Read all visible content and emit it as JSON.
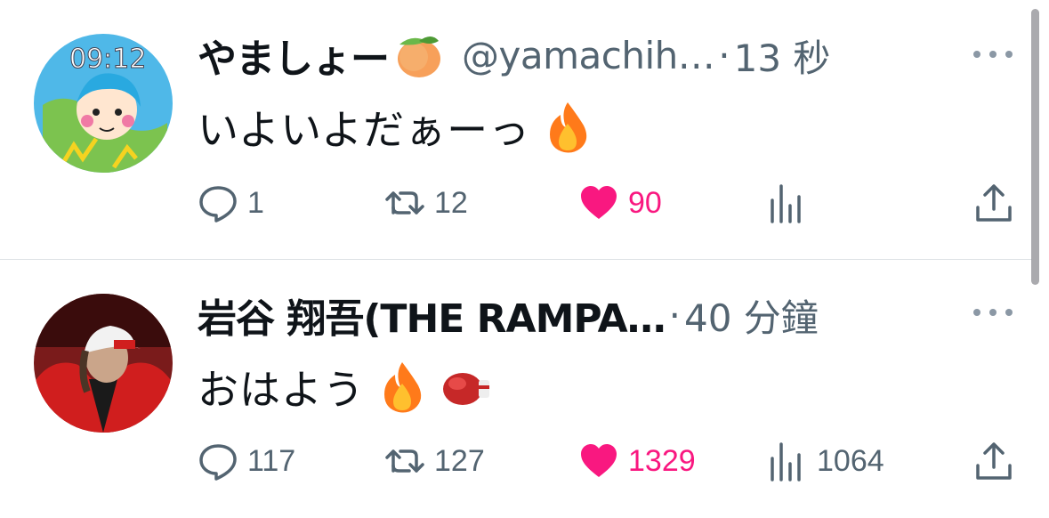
{
  "tweets": [
    {
      "display_name": "やましょー",
      "name_emoji": "peach-emoji",
      "handle": "@yamachih…",
      "separator": "·",
      "time": "13 秒",
      "text": "いよいよだぁーっ",
      "text_emojis": [
        "fire-emoji"
      ],
      "avatar_text": "09:12",
      "counts": {
        "replies": "1",
        "retweets": "12",
        "likes": "90",
        "views": ""
      }
    },
    {
      "display_name": "岩谷 翔吾(THE RAMPA…",
      "separator": "·",
      "time": "40 分鐘",
      "text": "おはよう",
      "text_emojis": [
        "fire-emoji",
        "boxing-glove-emoji"
      ],
      "counts": {
        "replies": "117",
        "retweets": "127",
        "likes": "1329",
        "views": "1064"
      }
    }
  ],
  "colors": {
    "text_primary": "#0f1419",
    "text_secondary": "#536471",
    "like_active": "#f91880",
    "divider": "#dfe3e6"
  }
}
